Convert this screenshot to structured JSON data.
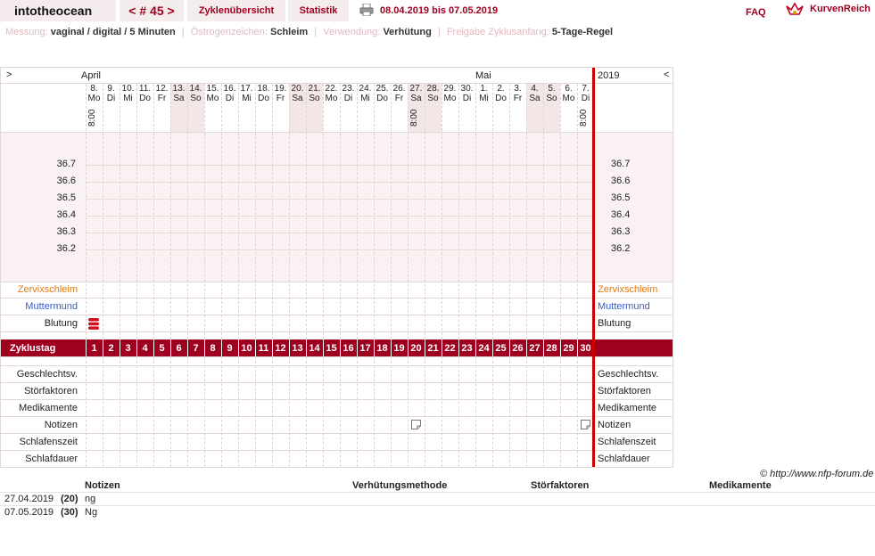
{
  "header": {
    "site_name": "intotheocean",
    "cycle_nav": "< # 45 >",
    "tab_cycles": "Zyklenübersicht",
    "tab_stats": "Statistik",
    "date_range": "08.04.2019 bis 07.05.2019",
    "faq": "FAQ",
    "brand": "KurvenReich",
    "colors": {
      "accent": "#a00020",
      "tab_bg": "#f5eded"
    }
  },
  "info": {
    "measure_label": "Messung:",
    "measure_value": "vaginal / digital / 5 Minuten",
    "estrogen_label": "Östrogenzeichen:",
    "estrogen_value": "Schleim",
    "usage_label": "Verwendung:",
    "usage_value": "Verhütung",
    "release_label": "Freigabe Zyklusanfang:",
    "release_value": "5-Tage-Regel"
  },
  "chart": {
    "nav_left": ">",
    "nav_right": "<",
    "year": "2019",
    "month_april": "April",
    "month_may": "Mai",
    "days": [
      {
        "n": "8.",
        "d": "Mo",
        "t": "8:00",
        "we": false
      },
      {
        "n": "9.",
        "d": "Di",
        "t": "",
        "we": false
      },
      {
        "n": "10.",
        "d": "Mi",
        "t": "",
        "we": false
      },
      {
        "n": "11.",
        "d": "Do",
        "t": "",
        "we": false
      },
      {
        "n": "12.",
        "d": "Fr",
        "t": "",
        "we": false
      },
      {
        "n": "13.",
        "d": "Sa",
        "t": "",
        "we": true
      },
      {
        "n": "14.",
        "d": "So",
        "t": "",
        "we": true
      },
      {
        "n": "15.",
        "d": "Mo",
        "t": "",
        "we": false
      },
      {
        "n": "16.",
        "d": "Di",
        "t": "",
        "we": false
      },
      {
        "n": "17.",
        "d": "Mi",
        "t": "",
        "we": false
      },
      {
        "n": "18.",
        "d": "Do",
        "t": "",
        "we": false
      },
      {
        "n": "19.",
        "d": "Fr",
        "t": "",
        "we": false
      },
      {
        "n": "20.",
        "d": "Sa",
        "t": "",
        "we": true
      },
      {
        "n": "21.",
        "d": "So",
        "t": "",
        "we": true
      },
      {
        "n": "22.",
        "d": "Mo",
        "t": "",
        "we": false
      },
      {
        "n": "23.",
        "d": "Di",
        "t": "",
        "we": false
      },
      {
        "n": "24.",
        "d": "Mi",
        "t": "",
        "we": false
      },
      {
        "n": "25.",
        "d": "Do",
        "t": "",
        "we": false
      },
      {
        "n": "26.",
        "d": "Fr",
        "t": "",
        "we": false
      },
      {
        "n": "27.",
        "d": "Sa",
        "t": "8:00",
        "we": true
      },
      {
        "n": "28.",
        "d": "So",
        "t": "",
        "we": true
      },
      {
        "n": "29.",
        "d": "Mo",
        "t": "",
        "we": false
      },
      {
        "n": "30.",
        "d": "Di",
        "t": "",
        "we": false
      },
      {
        "n": "1.",
        "d": "Mi",
        "t": "",
        "we": false
      },
      {
        "n": "2.",
        "d": "Do",
        "t": "",
        "we": false
      },
      {
        "n": "3.",
        "d": "Fr",
        "t": "",
        "we": false
      },
      {
        "n": "4.",
        "d": "Sa",
        "t": "",
        "we": true
      },
      {
        "n": "5.",
        "d": "So",
        "t": "",
        "we": true
      },
      {
        "n": "6.",
        "d": "Mo",
        "t": "",
        "we": false
      },
      {
        "n": "7.",
        "d": "Di",
        "t": "8:00",
        "we": false
      }
    ],
    "temps": [
      "36.7",
      "36.6",
      "36.5",
      "36.4",
      "36.3",
      "36.2"
    ],
    "rows_upper": [
      "Zervixschleim",
      "Muttermund",
      "Blutung"
    ],
    "cycle_day_label": "Zyklustag",
    "cycle_days": [
      "1",
      "2",
      "3",
      "4",
      "5",
      "6",
      "7",
      "8",
      "9",
      "10",
      "11",
      "12",
      "13",
      "14",
      "15",
      "16",
      "17",
      "18",
      "19",
      "20",
      "21",
      "22",
      "23",
      "24",
      "25",
      "26",
      "27",
      "28",
      "29",
      "30"
    ],
    "rows_lower": [
      "Geschlechtsv.",
      "Störfaktoren",
      "Medikamente",
      "Notizen",
      "Schlafenszeit",
      "Schlafdauer"
    ],
    "bleeding_day_index": 0,
    "note_day_indices": [
      19,
      29
    ],
    "colors": {
      "cervix": "#e07a10",
      "mouth": "#3a5bc8",
      "bar": "#a00020",
      "weekend": "#f3e6e6",
      "line": "#cc0000"
    }
  },
  "copyright": "© http://www.nfp-forum.de",
  "notes_table": {
    "headers": [
      "Notizen",
      "Verhütungsmethode",
      "Störfaktoren",
      "Medikamente"
    ],
    "rows": [
      {
        "date": "27.04.2019",
        "day": "(20)",
        "note": "ng"
      },
      {
        "date": "07.05.2019",
        "day": "(30)",
        "note": "Ng"
      }
    ]
  }
}
